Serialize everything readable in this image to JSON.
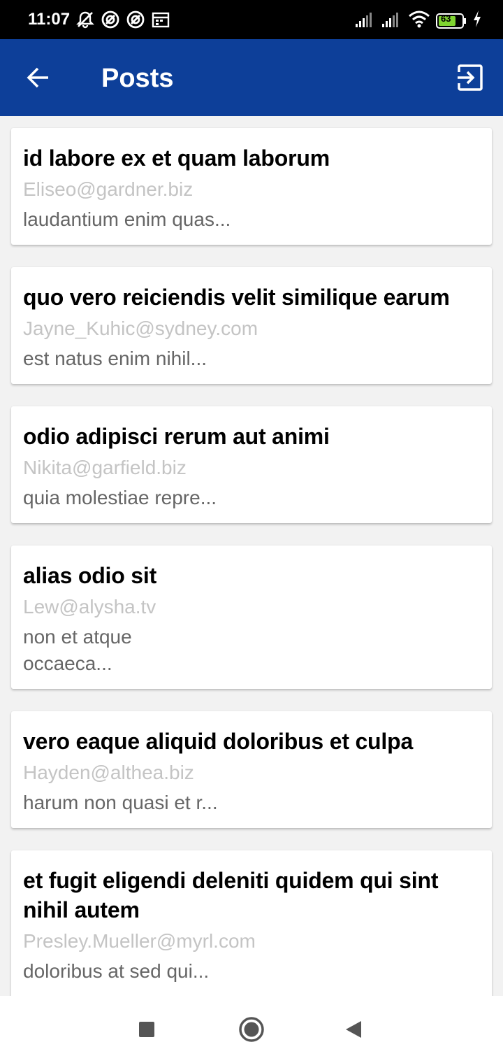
{
  "status_bar": {
    "time": "11:07",
    "battery_level": "63",
    "icons": [
      "mute-icon",
      "app-notification-icon",
      "app-notification-icon",
      "calendar-icon",
      "signal-icon",
      "signal-icon",
      "wifi-icon",
      "battery-icon",
      "charging-icon"
    ]
  },
  "app_bar": {
    "title": "Posts",
    "back_icon": "arrow-left-icon",
    "logout_icon": "logout-icon",
    "color": "#0d3f99"
  },
  "posts": [
    {
      "title": "id labore ex et quam laborum",
      "email": "Eliseo@gardner.biz",
      "body": "laudantium enim quas..."
    },
    {
      "title": "quo vero reiciendis velit similique earum",
      "email": "Jayne_Kuhic@sydney.com",
      "body": "est natus enim nihil..."
    },
    {
      "title": "odio adipisci rerum aut animi",
      "email": "Nikita@garfield.biz",
      "body": "quia molestiae repre..."
    },
    {
      "title": "alias odio sit",
      "email": "Lew@alysha.tv",
      "body": "non et atque\noccaeca..."
    },
    {
      "title": "vero eaque aliquid doloribus et culpa",
      "email": "Hayden@althea.biz",
      "body": "harum non quasi et r..."
    },
    {
      "title": "et fugit eligendi deleniti quidem qui sint nihil autem",
      "email": "Presley.Mueller@myrl.com",
      "body": "doloribus at sed qui..."
    }
  ],
  "nav_bar": {
    "icons": [
      "recents-icon",
      "home-icon",
      "back-icon"
    ]
  }
}
